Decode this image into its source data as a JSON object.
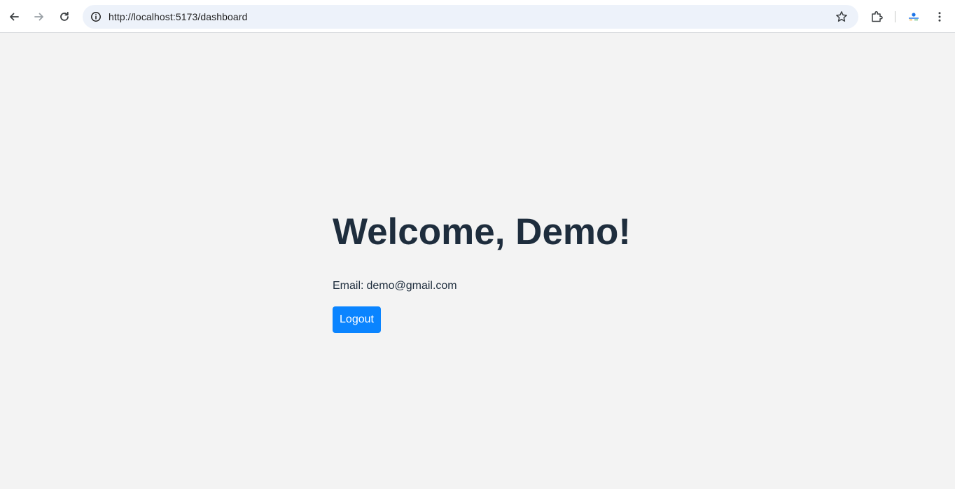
{
  "browser": {
    "url": "http://localhost:5173/dashboard",
    "icons": [
      "back-icon",
      "forward-icon",
      "reload-icon",
      "site-info-icon",
      "bookmark-star-icon",
      "extensions-icon",
      "profile-avatar",
      "menu-icon"
    ]
  },
  "page": {
    "heading": "Welcome, Demo!",
    "email_label": "Email:",
    "email_value": "demo@gmail.com",
    "logout_label": "Logout"
  },
  "colors": {
    "page_background": "#f3f3f3",
    "text": "#1e2d3d",
    "button": "#0a84ff",
    "button_text": "#ffffff"
  }
}
